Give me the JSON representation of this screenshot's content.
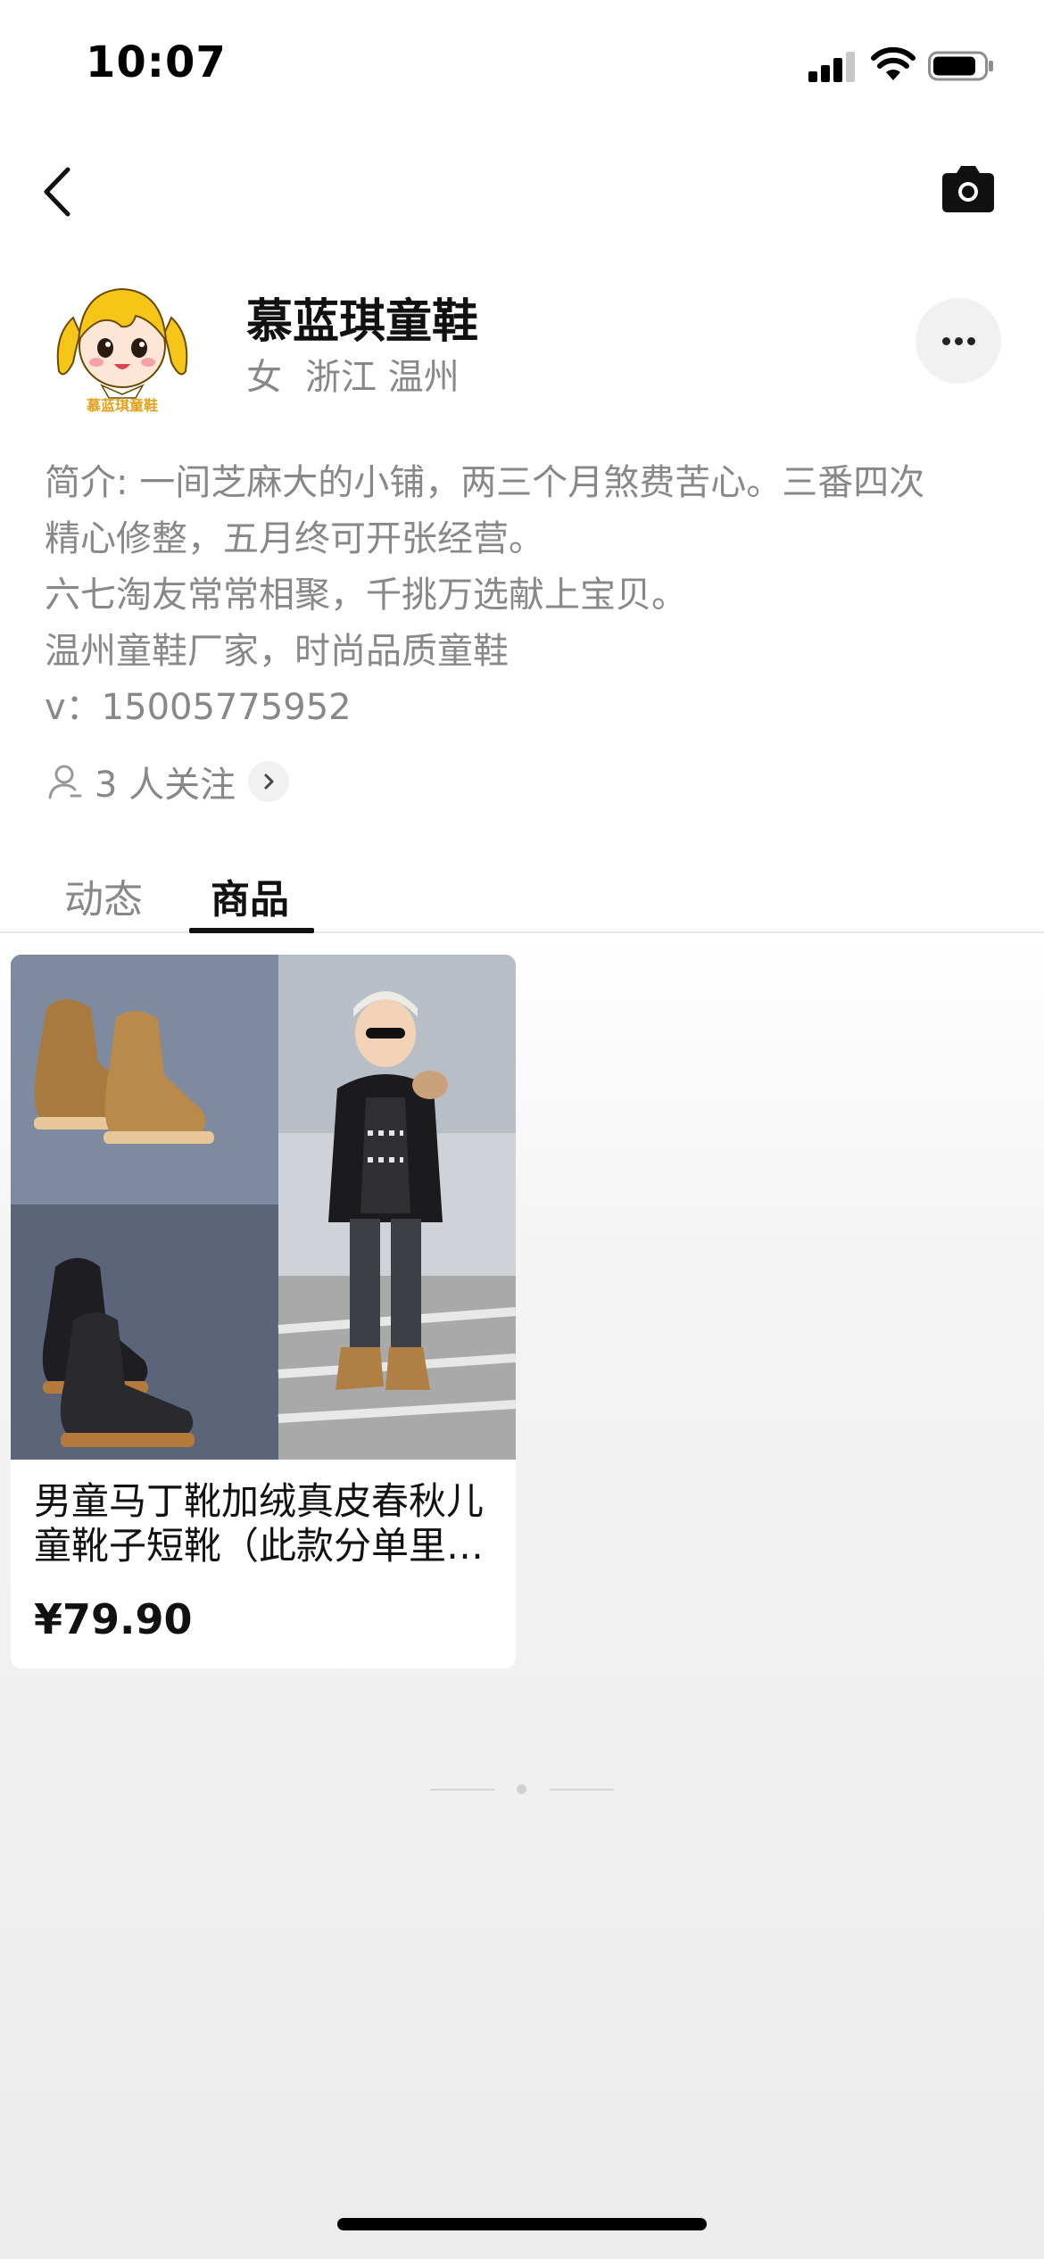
{
  "status_bar": {
    "time": "10:07"
  },
  "profile": {
    "name": "慕蓝琪童鞋",
    "avatar_text": "慕蓝琪童鞋",
    "gender": "女",
    "location": "浙江 温州",
    "bio_lines": [
      "简介: 一间芝麻大的小铺，两三个月煞费苦心。三番四次",
      "精心修整，五月终可开张经营。",
      "六七淘友常常相聚，千挑万选献上宝贝。",
      "温州童鞋厂家，时尚品质童鞋",
      "v：15005775952"
    ],
    "followers": "3 人关注"
  },
  "tabs": [
    {
      "label": "动态",
      "active": false
    },
    {
      "label": "商品",
      "active": true
    }
  ],
  "products": [
    {
      "title_line1": "男童马丁靴加绒真皮春秋儿",
      "title_line2": "童靴子短靴（此款分单里…",
      "price": "¥79.90"
    }
  ],
  "icons": {
    "back": "chevron-left-icon",
    "camera": "camera-icon",
    "more": "more-icon",
    "followers": "person-icon"
  },
  "colors": {
    "text_primary": "#111111",
    "text_secondary": "#888888",
    "chip_bg": "#f1f1f1"
  }
}
